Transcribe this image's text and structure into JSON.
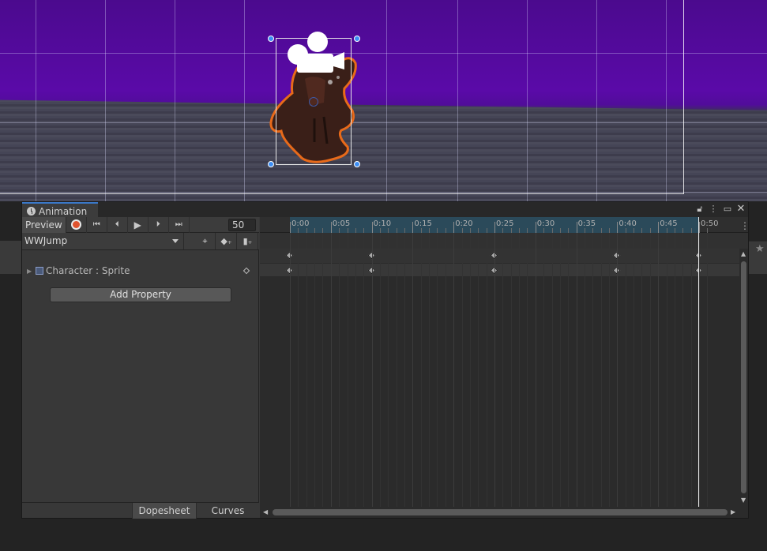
{
  "window": {
    "title": "Animation"
  },
  "toolbar": {
    "preview_label": "Preview",
    "frame_value": "50"
  },
  "clip": {
    "name": "WWJump"
  },
  "property": {
    "label": "Character : Sprite"
  },
  "add_property_label": "Add Property",
  "bottom_tabs": {
    "dopesheet": "Dopesheet",
    "curves": "Curves"
  },
  "timeline": {
    "tick_labels": [
      "0:00",
      "0:05",
      "0:10",
      "0:15",
      "0:20",
      "0:25",
      "0:30",
      "0:35",
      "0:40",
      "0:45",
      "0:50"
    ],
    "keyframes": [
      "0:00",
      "0:10",
      "0:25",
      "0:40",
      "0:50"
    ],
    "playhead": "0:50"
  },
  "colors": {
    "record": "#e0532e",
    "selection_handle": "#3d8ef5",
    "tab_accent": "#3a78c9"
  },
  "icons": {
    "tab": "clock-icon",
    "scene_camera": "camera-gizmo-icon"
  }
}
